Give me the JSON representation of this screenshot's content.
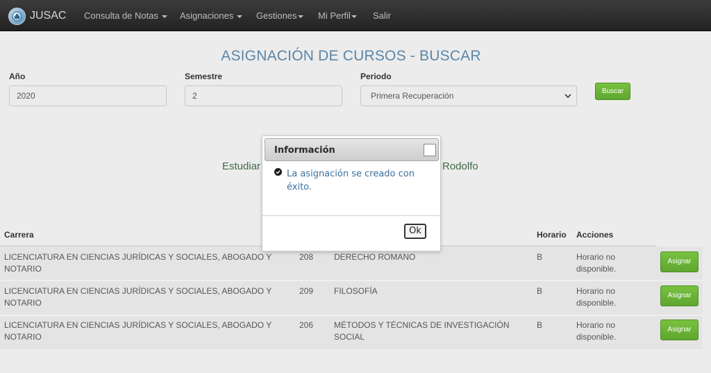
{
  "navbar": {
    "brand": "JUSAC",
    "menu": [
      {
        "label": "Consulta de Notas",
        "has_caret": true
      },
      {
        "label": "Asignaciones",
        "has_caret": true
      },
      {
        "label": "Gestiones",
        "has_caret": true
      },
      {
        "label": "Mi Perfil",
        "has_caret": true
      },
      {
        "label": "Salir",
        "has_caret": false
      }
    ]
  },
  "page": {
    "title": "ASIGNACIÓN DE CURSOS - BUSCAR"
  },
  "form": {
    "anio_label": "Año",
    "anio_value": "2020",
    "semestre_label": "Semestre",
    "semestre_value": "2",
    "periodo_label": "Periodo",
    "periodo_value": "Primera Recuperación",
    "buscar_label": "Buscar"
  },
  "student": {
    "left_fragment": "Estudiar",
    "right_fragment": "Rodolfo"
  },
  "table": {
    "headers": {
      "carrera": "Carrera",
      "horario": "Horario",
      "acciones": "Acciones"
    },
    "rows": [
      {
        "carrera": "LICENCIATURA EN CIENCIAS JURÍDICAS Y SOCIALES, ABOGADO Y NOTARIO",
        "codigo": "208",
        "curso": "DERECHO ROMANO",
        "seccion": "B",
        "horario": "Horario no disponible.",
        "accion": "Asignar"
      },
      {
        "carrera": "LICENCIATURA EN CIENCIAS JURÍDICAS Y SOCIALES, ABOGADO Y NOTARIO",
        "codigo": "209",
        "curso": "FILOSOFÍA",
        "seccion": "B",
        "horario": "Horario no disponible.",
        "accion": "Asignar"
      },
      {
        "carrera": "LICENCIATURA EN CIENCIAS JURÍDICAS Y SOCIALES, ABOGADO Y NOTARIO",
        "codigo": "206",
        "curso": "MÉTODOS Y TÉCNICAS DE INVESTIGACIÓN SOCIAL",
        "seccion": "B",
        "horario": "Horario no disponible.",
        "accion": "Asignar"
      }
    ]
  },
  "modal": {
    "title": "Información",
    "message": "La asignación se creado con éxito.",
    "ok_label": "Ok"
  },
  "colors": {
    "navbar_bg": "#222222",
    "title_blue": "#5b86a8",
    "button_green": "#5ea62e",
    "student_green": "#3f6b45",
    "message_blue": "#3a6f9c"
  },
  "icons": {
    "brand": "university-seal-icon",
    "dropdown": "chevron-down-icon",
    "success": "check-circle-icon",
    "close": "close-checkbox-icon"
  }
}
